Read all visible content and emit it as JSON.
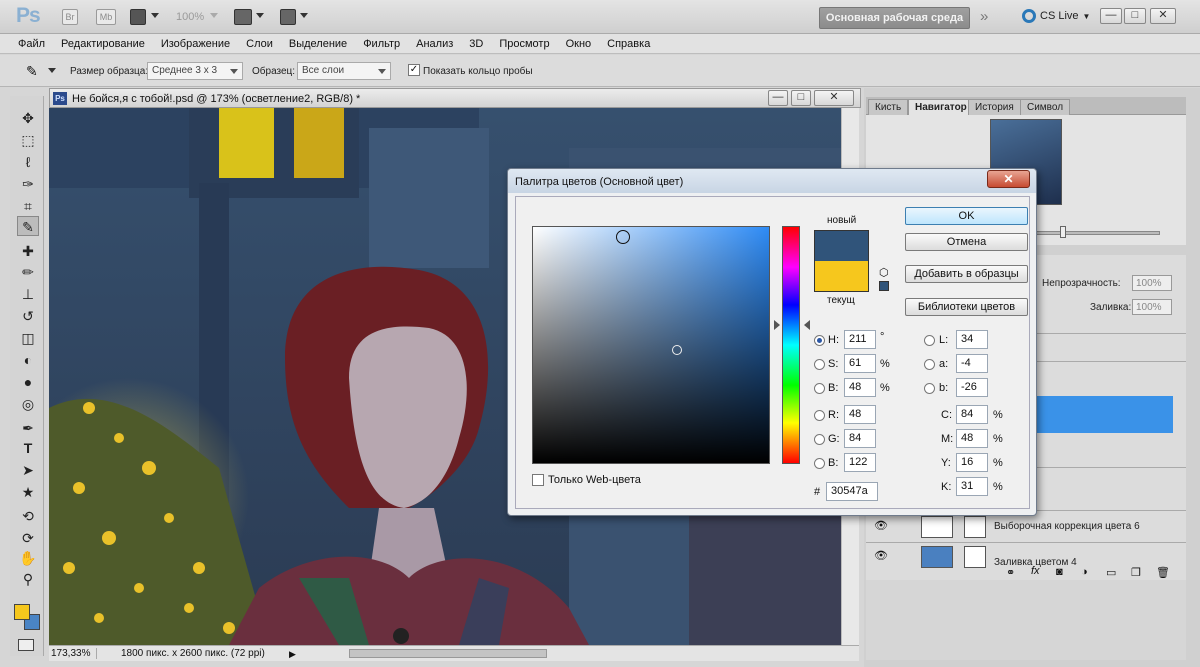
{
  "appbar": {
    "logo": "Ps",
    "icons": [
      "bridge-icon",
      "minibridge-icon",
      "view-extras-icon",
      "zoom-level",
      "arrange-icon",
      "screen-mode-icon"
    ],
    "bridge_label": "Br",
    "minibridge_label": "Mb",
    "zoom_value": "100%",
    "workspace": "Основная рабочая среда",
    "more_chevron": "»",
    "cs_live": "CS Live",
    "window_controls": {
      "minimize": "—",
      "maximize": "□",
      "close": "✕"
    }
  },
  "menu": [
    "Файл",
    "Редактирование",
    "Изображение",
    "Слои",
    "Выделение",
    "Фильтр",
    "Анализ",
    "3D",
    "Просмотр",
    "Окно",
    "Справка"
  ],
  "options": {
    "sample_size_label": "Размер образца:",
    "sample_size_value": "Среднее 3 х 3",
    "sample_label": "Образец:",
    "sample_value": "Все слои",
    "show_ring_label": "Показать кольцо пробы",
    "show_ring_checked": true
  },
  "tools": [
    "move-tool",
    "marquee-tool",
    "lasso-tool",
    "quick-select-tool",
    "crop-tool",
    "eyedropper-tool",
    "healing-tool",
    "brush-tool",
    "stamp-tool",
    "history-brush-tool",
    "eraser-tool",
    "paint-bucket-tool",
    "blur-tool",
    "dodge-tool",
    "pen-tool",
    "type-tool",
    "path-select-tool",
    "shape-tool",
    "3d-rotate-tool",
    "3d-orbit-tool",
    "hand-tool",
    "zoom-tool"
  ],
  "tool_glyphs": {
    "type": "T"
  },
  "active_tool": "eyedropper-tool",
  "foreground_color": "#f6c71d",
  "background_color": "#4a84c4",
  "document": {
    "title": "Не бойся,я с тобой!.psd @ 173% (осветление2, RGB/8) *",
    "ps_badge": "Ps",
    "zoom": "173,33%",
    "info": "1800 пикс. x 2600 пикс. (72 ppi)"
  },
  "panels": {
    "tabs": [
      "Кисть",
      "Навигатор",
      "История",
      "Символ"
    ],
    "active_tab": "Навигатор",
    "opacity_label": "Непрозрачность:",
    "opacity_value": "100%",
    "fill_label": "Заливка:",
    "fill_value": "100%",
    "layers": [
      "Выборочная коррекция цвета 6",
      "Заливка цветом 4"
    ],
    "selected_layer_color": "#3a92e8"
  },
  "dialog": {
    "title": "Палитра цветов (Основной цвет)",
    "close": "✕",
    "new_label": "новый",
    "current_label": "текущ",
    "new_color": "#30547a",
    "current_color": "#f6c71d",
    "buttons": {
      "ok": "OK",
      "cancel": "Отмена",
      "add_swatch": "Добавить в образцы",
      "libraries": "Библиотеки цветов"
    },
    "web_only_label": "Только Web-цвета",
    "web_only_checked": false,
    "hsb": {
      "h": "211",
      "s": "61",
      "b": "48",
      "h_unit": "°",
      "s_unit": "%",
      "b_unit": "%",
      "selected": "H"
    },
    "rgb": {
      "r": "48",
      "g": "84",
      "b": "122"
    },
    "lab": {
      "l": "34",
      "a": "-4",
      "b": "-26"
    },
    "cmyk": {
      "c": "84",
      "m": "48",
      "y": "16",
      "k": "31",
      "unit": "%"
    },
    "hex_label": "#",
    "hex": "30547a",
    "labels": {
      "h": "H:",
      "s": "S:",
      "b": "B:",
      "r": "R:",
      "g": "G:",
      "b2": "B:",
      "l": "L:",
      "a": "a:",
      "lb": "b:",
      "c": "C:",
      "m": "M:",
      "y": "Y:",
      "k": "K:"
    }
  }
}
